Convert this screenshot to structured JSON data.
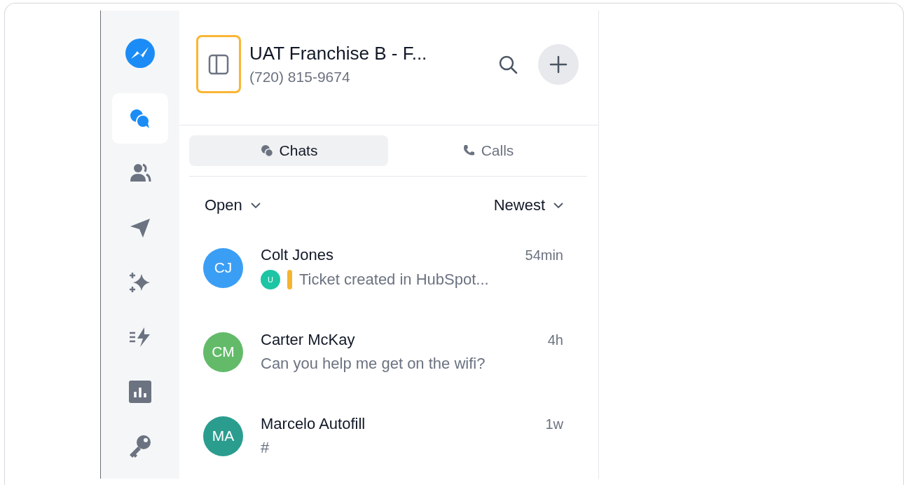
{
  "nav": [
    {
      "selected": true
    },
    {
      "selected": false
    },
    {
      "selected": false
    },
    {
      "selected": false
    },
    {
      "selected": false
    },
    {
      "selected": false
    },
    {
      "selected": false
    }
  ],
  "header": {
    "title": "UAT Franchise B - F...",
    "phone": "(720) 815-9674",
    "toggle_highlighted": true
  },
  "tabs": [
    {
      "label": "Chats",
      "selected": true
    },
    {
      "label": "Calls",
      "selected": false
    }
  ],
  "filters": {
    "status": "Open",
    "sort": "Newest"
  },
  "conversations": [
    {
      "initials": "CJ",
      "color": "#3b9ef5",
      "name": "Colt Jones",
      "time": "54min",
      "preview": "Ticket created in HubSpot...",
      "assignee": {
        "initials": "U",
        "color": "#1cc5a4"
      }
    },
    {
      "initials": "CM",
      "color": "#63bb6a",
      "name": "Carter McKay",
      "time": "4h",
      "preview": "Can you help me get on the wifi?"
    },
    {
      "initials": "MA",
      "color": "#2a9d8f",
      "name": "Marcelo Autofill",
      "time": "1w",
      "preview": "#"
    }
  ]
}
